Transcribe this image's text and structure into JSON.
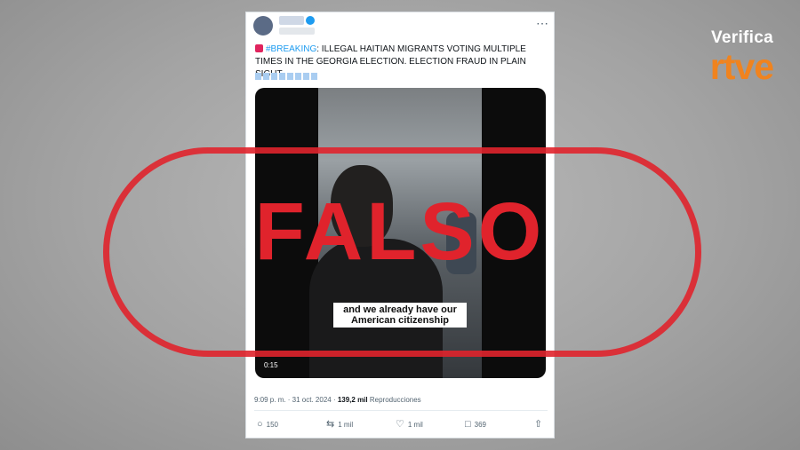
{
  "brand": {
    "verifica": "Verifica",
    "rtve": "rtve",
    "accent_color": "#f0831e"
  },
  "tweet": {
    "hashtag": "#BREAKING",
    "text": ": ILLEGAL HAITIAN MIGRANTS VOTING MULTIPLE TIMES IN THE GEORGIA ELECTION. ELECTION FRAUD IN PLAIN SIGHT.",
    "video": {
      "caption": "and we already have our American citizenship",
      "duration": "0:15"
    },
    "timestamp": "9:09 p. m. · 31 oct. 2024 · ",
    "views_count": "139,2 mil",
    "views_label": " Reproducciones",
    "actions": {
      "replies": "150",
      "reposts": "1 mil",
      "likes": "1 mil",
      "bookmarks": "369"
    }
  },
  "stamp": {
    "text": "FALSO",
    "color": "#e0232c"
  },
  "icons": {
    "reply": "reply-icon",
    "repost": "repost-icon",
    "like": "heart-icon",
    "bookmark": "bookmark-icon",
    "share": "share-icon",
    "more": "more-icon"
  }
}
